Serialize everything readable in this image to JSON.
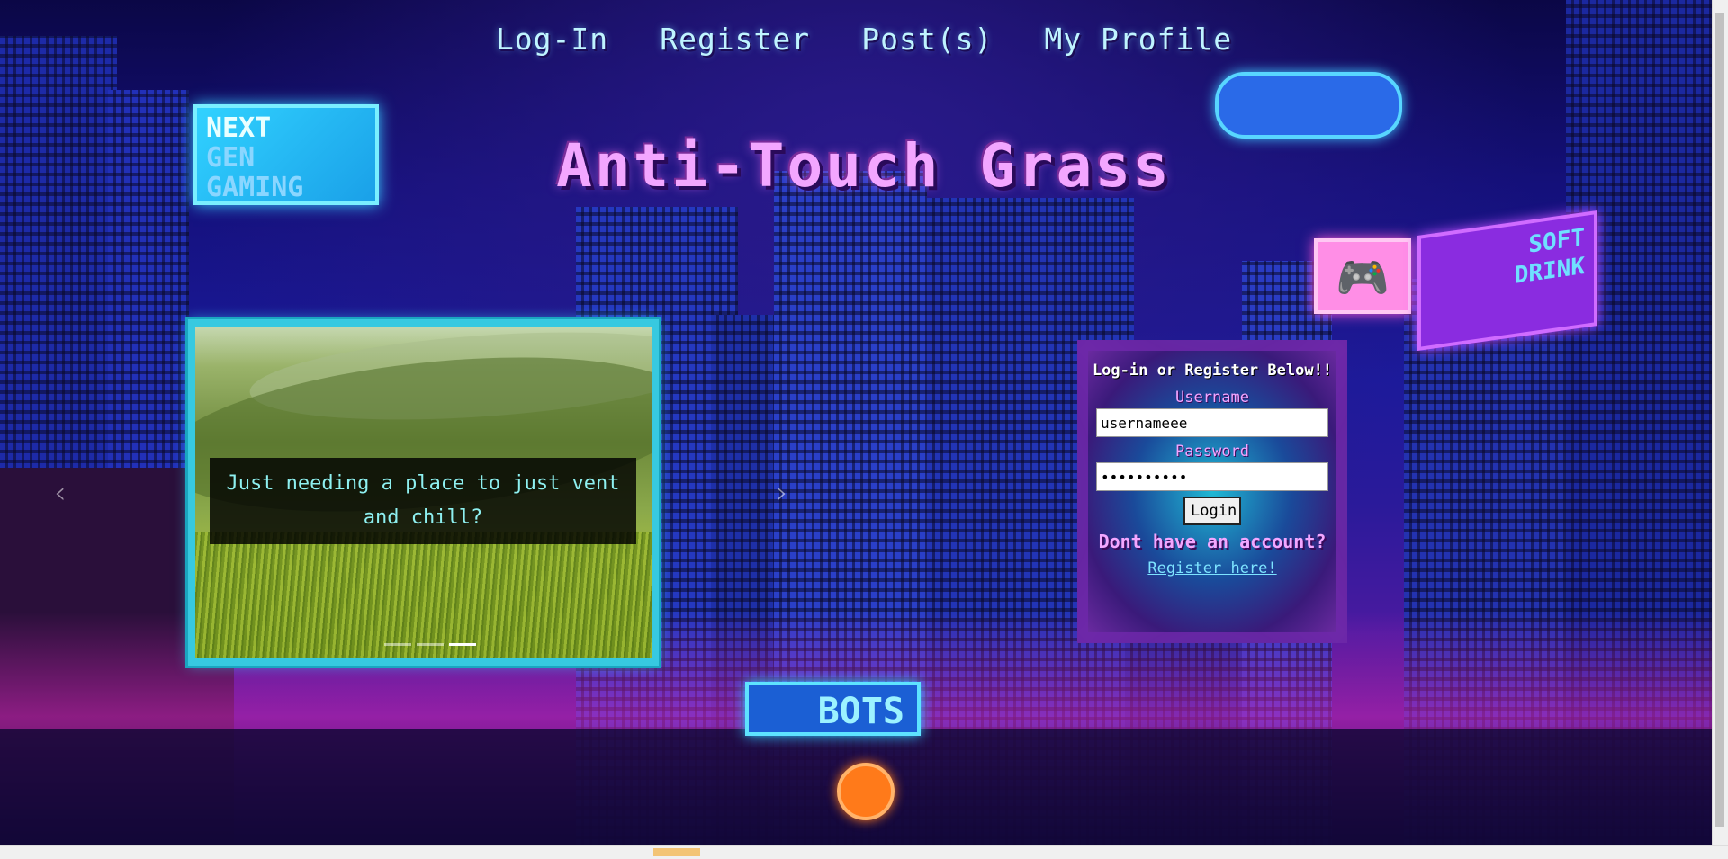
{
  "nav": {
    "items": [
      "Log-In",
      "Register",
      "Post(s)",
      "My Profile"
    ]
  },
  "site_title": "Anti-Touch Grass",
  "signs": {
    "nextgen": [
      "NEXT",
      "GEN",
      "GAMING"
    ],
    "bots": "BOTS",
    "soft": [
      "SOFT",
      "DRINK"
    ]
  },
  "carousel": {
    "caption": "Just needing a place to just vent and chill?",
    "slide_count": 3,
    "active_index": 2,
    "prev_symbol": "‹",
    "next_symbol": "›"
  },
  "login": {
    "heading": "Log-in or Register Below!!",
    "username_label": "Username",
    "username_value": "usernameee",
    "password_label": "Password",
    "password_value": "••••••••••",
    "submit_label": "Login",
    "no_account": "Dont have an account?",
    "register_link": "Register here!"
  },
  "colors": {
    "nav_text": "#bff4ff",
    "title": "#f3a6ff",
    "carousel_border": "#37c9e0",
    "caption_text": "#8ef0f0",
    "label_pink": "#f3a6ff",
    "link_cyan": "#7de4ff"
  }
}
